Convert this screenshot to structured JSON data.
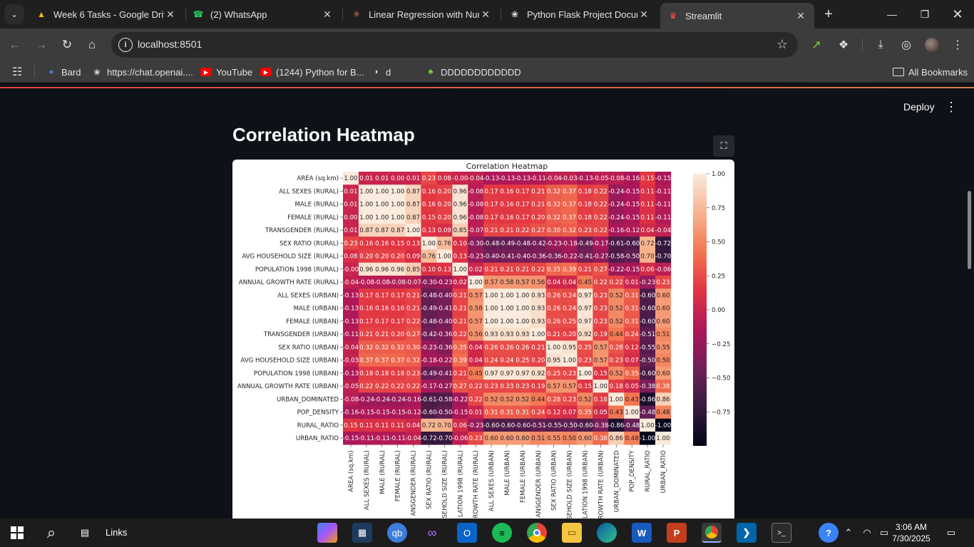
{
  "browser": {
    "tabs": [
      {
        "title": "Week 6 Tasks - Google Drive",
        "icon": "google-drive-icon",
        "color": "#fbbc04"
      },
      {
        "title": "(2) WhatsApp",
        "icon": "whatsapp-icon",
        "color": "#25d366"
      },
      {
        "title": "Linear Regression with Num",
        "icon": "claude-icon",
        "color": "#d97757"
      },
      {
        "title": "Python Flask Project Docume",
        "icon": "chatgpt-icon",
        "color": "#e3e3e3"
      },
      {
        "title": "Streamlit",
        "icon": "streamlit-icon",
        "color": "#ff4b4b",
        "active": true
      }
    ],
    "url": "localhost:8501",
    "bookmarks": [
      {
        "label": "Bard",
        "icon": "bard-icon"
      },
      {
        "label": "https://chat.openai....",
        "icon": "chatgpt-icon"
      },
      {
        "label": "YouTube",
        "icon": "youtube-icon"
      },
      {
        "label": "(1244) Python for B...",
        "icon": "youtube-icon"
      },
      {
        "label": "d",
        "icon": "globe-icon"
      },
      {
        "label": "DDDDDDDDDDDD",
        "icon": "app-icon"
      }
    ],
    "all_bookmarks": "All Bookmarks"
  },
  "streamlit": {
    "deploy": "Deploy",
    "title": "Correlation Heatmap"
  },
  "chart_data": {
    "type": "heatmap",
    "title": "Correlation Heatmap",
    "labels": [
      "AREA (sq.km)",
      "ALL SEXES (RURAL)",
      "MALE (RURAL)",
      "FEMALE (RURAL)",
      "TRANSGENDER (RURAL)",
      "SEX RATIO (RURAL)",
      "AVG HOUSEHOLD SIZE (RURAL)",
      "POPULATION 1998 (RURAL)",
      "ANNUAL GROWTH RATE (RURAL)",
      "ALL SEXES (URBAN)",
      "MALE (URBAN)",
      "FEMALE (URBAN)",
      "TRANSGENDER (URBAN)",
      "SEX RATIO (URBAN)",
      "AVG HOUSEHOLD SIZE (URBAN)",
      "POPULATION 1998 (URBAN)",
      "ANNUAL GROWTH RATE (URBAN)",
      "URBAN_DOMINATED",
      "POP_DENSITY",
      "RURAL_RATIO",
      "URBAN_RATIO"
    ],
    "x_tick_labels": [
      "AREA (sq.km)",
      "ALL SEXES (RURAL)",
      "MALE (RURAL)",
      "FEMALE (RURAL)",
      "ANSGENDER (RURAL)",
      "SEX RATIO (RURAL)",
      "SEHOLD SIZE (RURAL)",
      "LATION 1998 (RURAL)",
      "ROWTH RATE (RURAL)",
      "ALL SEXES (URBAN)",
      "MALE (URBAN)",
      "FEMALE (URBAN)",
      "ANSGENDER (URBAN)",
      "SEX RATIO (URBAN)",
      "SEHOLD SIZE (URBAN)",
      "LATION 1998 (URBAN)",
      "ROWTH RATE (URBAN)",
      "URBAN_DOMINATED",
      "POP_DENSITY",
      "RURAL_RATIO",
      "URBAN_RATIO"
    ],
    "matrix": [
      [
        1.0,
        0.01,
        0.01,
        0.0,
        0.01,
        0.23,
        0.08,
        -0.0,
        -0.04,
        -0.13,
        -0.13,
        -0.13,
        -0.11,
        -0.04,
        -0.03,
        -0.13,
        -0.05,
        -0.08,
        -0.16,
        0.15,
        -0.15
      ],
      [
        0.01,
        1.0,
        1.0,
        1.0,
        0.87,
        0.16,
        0.2,
        0.96,
        -0.08,
        0.17,
        0.16,
        0.17,
        0.21,
        0.32,
        0.37,
        0.18,
        0.22,
        -0.24,
        -0.15,
        0.11,
        -0.11
      ],
      [
        0.01,
        1.0,
        1.0,
        1.0,
        0.87,
        0.16,
        0.2,
        0.96,
        -0.08,
        0.17,
        0.16,
        0.17,
        0.21,
        0.32,
        0.37,
        0.18,
        0.22,
        -0.24,
        -0.15,
        0.11,
        -0.11
      ],
      [
        0.0,
        1.0,
        1.0,
        1.0,
        0.87,
        0.15,
        0.2,
        0.96,
        -0.08,
        0.17,
        0.16,
        0.17,
        0.2,
        0.32,
        0.37,
        0.18,
        0.22,
        -0.24,
        -0.15,
        0.11,
        -0.11
      ],
      [
        0.01,
        0.87,
        0.87,
        0.87,
        1.0,
        0.13,
        0.09,
        0.85,
        -0.07,
        0.21,
        0.21,
        0.22,
        0.27,
        0.3,
        0.32,
        0.23,
        0.22,
        -0.16,
        -0.12,
        0.04,
        -0.04
      ],
      [
        0.23,
        0.16,
        0.16,
        0.15,
        0.13,
        1.0,
        0.76,
        0.1,
        -0.3,
        -0.48,
        -0.49,
        -0.48,
        -0.42,
        -0.23,
        -0.18,
        -0.49,
        -0.17,
        -0.61,
        -0.6,
        0.72,
        -0.72
      ],
      [
        0.08,
        0.2,
        0.2,
        0.2,
        0.09,
        0.76,
        1.0,
        0.13,
        -0.23,
        -0.4,
        -0.41,
        -0.4,
        -0.36,
        -0.36,
        -0.22,
        -0.41,
        -0.27,
        -0.58,
        -0.5,
        0.7,
        -0.7
      ],
      [
        -0.0,
        0.96,
        0.96,
        0.96,
        0.85,
        0.1,
        0.13,
        1.0,
        0.02,
        0.21,
        0.21,
        0.21,
        0.22,
        0.35,
        0.39,
        0.21,
        0.27,
        -0.22,
        -0.15,
        0.06,
        -0.06
      ],
      [
        -0.04,
        -0.08,
        -0.08,
        -0.08,
        -0.07,
        -0.3,
        -0.23,
        0.02,
        1.0,
        0.57,
        0.58,
        0.57,
        0.56,
        0.04,
        0.04,
        0.45,
        0.22,
        0.22,
        0.01,
        -0.23,
        0.23
      ],
      [
        -0.13,
        0.17,
        0.17,
        0.17,
        0.21,
        -0.48,
        -0.4,
        0.21,
        0.57,
        1.0,
        1.0,
        1.0,
        0.93,
        0.26,
        0.24,
        0.97,
        0.23,
        0.52,
        0.31,
        -0.6,
        0.6
      ],
      [
        -0.13,
        0.16,
        0.16,
        0.16,
        0.21,
        -0.49,
        -0.41,
        0.21,
        0.58,
        1.0,
        1.0,
        1.0,
        0.93,
        0.26,
        0.24,
        0.97,
        0.23,
        0.52,
        0.31,
        -0.6,
        0.6
      ],
      [
        -0.13,
        0.17,
        0.17,
        0.17,
        0.22,
        -0.48,
        -0.4,
        0.21,
        0.57,
        1.0,
        1.0,
        1.0,
        0.93,
        0.26,
        0.25,
        0.97,
        0.23,
        0.52,
        0.31,
        -0.6,
        0.6
      ],
      [
        -0.11,
        0.21,
        0.21,
        0.2,
        0.27,
        -0.42,
        -0.36,
        0.22,
        0.56,
        0.93,
        0.93,
        0.93,
        1.0,
        0.21,
        0.2,
        0.92,
        0.19,
        0.44,
        0.24,
        -0.51,
        0.51
      ],
      [
        -0.04,
        0.32,
        0.32,
        0.32,
        0.3,
        -0.23,
        -0.36,
        0.35,
        0.04,
        0.26,
        0.26,
        0.26,
        0.21,
        1.0,
        0.95,
        0.25,
        0.57,
        0.28,
        0.12,
        -0.55,
        0.55
      ],
      [
        -0.03,
        0.37,
        0.37,
        0.37,
        0.32,
        -0.18,
        -0.22,
        0.39,
        0.04,
        0.24,
        0.24,
        0.25,
        0.2,
        0.95,
        1.0,
        0.23,
        0.57,
        0.23,
        0.07,
        -0.5,
        0.5
      ],
      [
        -0.13,
        0.18,
        0.18,
        0.18,
        0.23,
        -0.49,
        -0.41,
        0.21,
        0.45,
        0.97,
        0.97,
        0.97,
        0.92,
        0.25,
        0.23,
        1.0,
        0.15,
        0.52,
        0.35,
        -0.6,
        0.6
      ],
      [
        -0.05,
        0.22,
        0.22,
        0.22,
        0.22,
        -0.17,
        -0.27,
        0.27,
        0.22,
        0.23,
        0.23,
        0.23,
        0.19,
        0.57,
        0.57,
        0.15,
        1.0,
        0.18,
        0.05,
        -0.38,
        0.38
      ],
      [
        -0.08,
        -0.24,
        -0.24,
        -0.24,
        -0.16,
        -0.61,
        -0.58,
        -0.22,
        0.22,
        0.52,
        0.52,
        0.52,
        0.44,
        0.28,
        0.23,
        0.52,
        0.18,
        1.0,
        0.43,
        -0.86,
        0.86
      ],
      [
        -0.16,
        -0.15,
        -0.15,
        -0.15,
        -0.12,
        -0.6,
        -0.5,
        -0.15,
        0.01,
        0.31,
        0.31,
        0.31,
        0.24,
        0.12,
        0.07,
        0.35,
        0.05,
        0.43,
        1.0,
        -0.48,
        0.48
      ],
      [
        0.15,
        0.11,
        0.11,
        0.11,
        0.04,
        0.72,
        0.7,
        0.06,
        -0.23,
        -0.6,
        -0.6,
        -0.6,
        -0.51,
        -0.55,
        -0.5,
        -0.6,
        -0.38,
        -0.86,
        -0.48,
        1.0,
        -1.0
      ],
      [
        -0.15,
        -0.11,
        -0.11,
        -0.11,
        -0.04,
        -0.72,
        -0.7,
        -0.06,
        0.23,
        0.6,
        0.6,
        0.6,
        0.51,
        0.55,
        0.5,
        0.6,
        0.38,
        0.86,
        0.48,
        -1.0,
        1.0
      ]
    ],
    "vmin": -1.0,
    "vmax": 1.0,
    "colorbar_ticks": [
      "1.00",
      "0.75",
      "0.50",
      "0.25",
      "0.00",
      "−0.25",
      "−0.50",
      "−0.75"
    ],
    "colorbar_tick_values": [
      1.0,
      0.75,
      0.5,
      0.25,
      0.0,
      -0.25,
      -0.5,
      -0.75
    ],
    "colormap": "rocket",
    "colormap_stops": [
      "#03051a",
      "#35193e",
      "#701f57",
      "#ad1759",
      "#e13342",
      "#f37651",
      "#f6b48f",
      "#faebdd"
    ]
  },
  "taskbar": {
    "links_label": "Links",
    "time": "3:06 AM",
    "date": "7/30/2025"
  }
}
